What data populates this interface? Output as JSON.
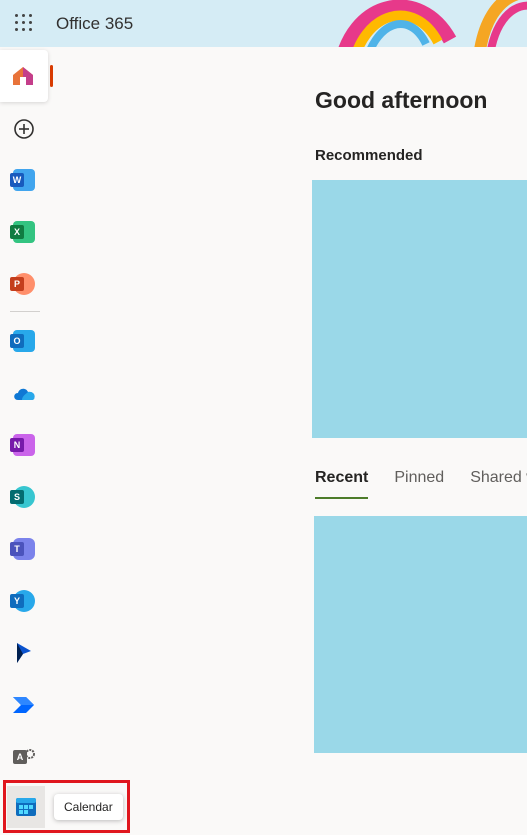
{
  "topbar": {
    "app_launcher_icon": "waffle-icon",
    "brand": "Office 365"
  },
  "sidebar": {
    "items": [
      {
        "name": "home",
        "icon": "home-icon"
      },
      {
        "name": "create",
        "icon": "add-circle-icon"
      },
      {
        "name": "word",
        "icon": "word-icon",
        "letter": "W",
        "color": "#185abd"
      },
      {
        "name": "excel",
        "icon": "excel-icon",
        "letter": "X",
        "color": "#107c41"
      },
      {
        "name": "powerpoint",
        "icon": "powerpoint-icon",
        "letter": "P",
        "color": "#c43e1c"
      },
      {
        "name": "outlook",
        "icon": "outlook-icon",
        "letter": "O",
        "color": "#0f6cbd"
      },
      {
        "name": "onedrive",
        "icon": "onedrive-icon"
      },
      {
        "name": "onenote",
        "icon": "onenote-icon",
        "letter": "N",
        "color": "#7719aa"
      },
      {
        "name": "sharepoint",
        "icon": "sharepoint-icon",
        "letter": "S",
        "color": "#036c70"
      },
      {
        "name": "teams",
        "icon": "teams-icon",
        "letter": "T",
        "color": "#4b53bc"
      },
      {
        "name": "yammer",
        "icon": "yammer-icon",
        "letter": "Y",
        "color": "#0f6cbd"
      },
      {
        "name": "dynamics",
        "icon": "dynamics-icon"
      },
      {
        "name": "power-automate",
        "icon": "power-automate-icon"
      },
      {
        "name": "admin",
        "icon": "admin-icon",
        "letter": "A",
        "color": "#605e5c"
      },
      {
        "name": "calendar",
        "icon": "calendar-icon"
      }
    ]
  },
  "main": {
    "greeting": "Good afternoon",
    "recommended_label": "Recommended",
    "tabs": [
      {
        "label": "Recent",
        "active": true
      },
      {
        "label": "Pinned",
        "active": false
      },
      {
        "label": "Shared w",
        "active": false
      }
    ]
  },
  "tooltip": {
    "text": "Calendar"
  },
  "colors": {
    "accent_home": "#d83b01",
    "card_fill": "#9ad8e8",
    "highlight": "#e0161e",
    "tab_underline": "#4d7c2a"
  }
}
